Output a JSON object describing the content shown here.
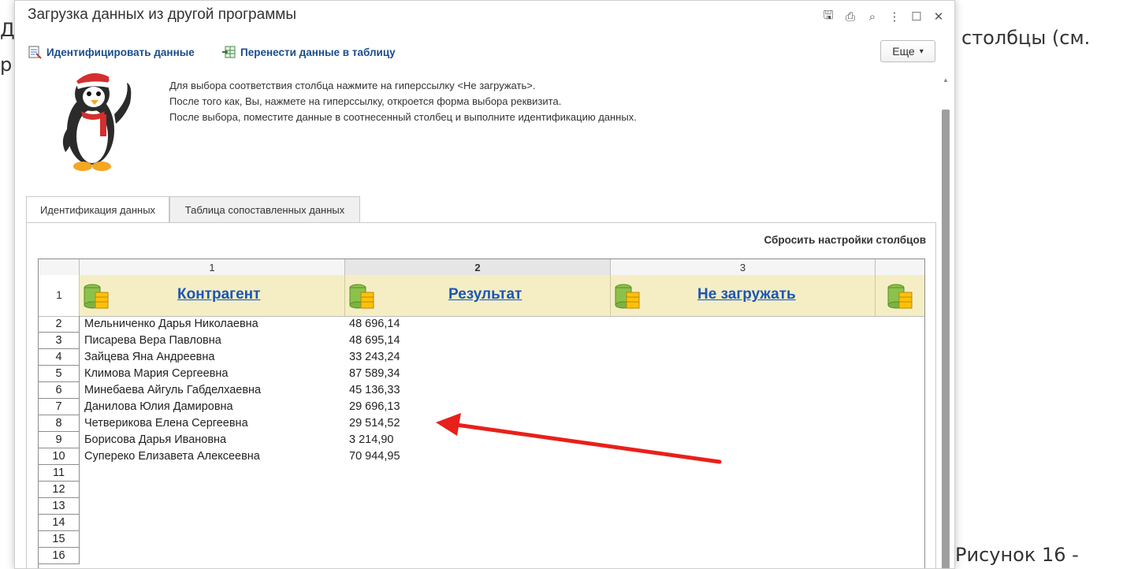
{
  "background": {
    "left_fragment_line1": "Д",
    "left_fragment_line2": "р",
    "right_fragment": "столбцы (см.",
    "figure_caption": "Рисунок 16 -"
  },
  "window": {
    "title": "Загрузка данных из другой программы",
    "title_icons": [
      "save-icon",
      "print-icon",
      "preview-icon",
      "more-vert-icon",
      "maximize-icon",
      "close-icon"
    ],
    "title_glyphs": {
      "save": "🖫",
      "print": "⎙",
      "preview": "⌕",
      "more": "⋮",
      "maximize": "☐",
      "close": "✕"
    }
  },
  "command_bar": {
    "identify_label": "Идентифицировать данные",
    "transfer_label": "Перенести данные в таблицу",
    "more_label": "Еще",
    "more_arrow": "▾"
  },
  "info": {
    "line1": "Для выбора соответствия столбца нажмите на гиперссылку <Не загружать>.",
    "line2": "После того как, Вы, нажмете на гиперссылку, откроется форма выбора реквизита.",
    "line3": "После выбора, поместите данные в соотнесенный столбец и выполните идентификацию данных."
  },
  "tabs": [
    {
      "label": "Идентификация данных",
      "active": true
    },
    {
      "label": "Таблица сопоставленных данных",
      "active": false
    }
  ],
  "reset_label": "Сбросить настройки столбцов",
  "grid": {
    "column_numbers": [
      "1",
      "2",
      "3"
    ],
    "header_row_number": "1",
    "column_names": [
      "Контрагент",
      "Результат",
      "Не загружать"
    ],
    "rows": [
      {
        "n": "2",
        "name": "Мельниченко Дарья Николаевна",
        "value": "48 696,14"
      },
      {
        "n": "3",
        "name": "Писарева Вера Павловна",
        "value": "48 695,14"
      },
      {
        "n": "4",
        "name": "Зайцева Яна Андреевна",
        "value": "33 243,24"
      },
      {
        "n": "5",
        "name": "Климова Мария Сергеевна",
        "value": "87 589,34"
      },
      {
        "n": "6",
        "name": "Минебаева Айгуль Габделхаевна",
        "value": "45 136,33"
      },
      {
        "n": "7",
        "name": "Данилова Юлия Дамировна",
        "value": "29 696,13"
      },
      {
        "n": "8",
        "name": "Четверикова Елена Сергеевна",
        "value": "29 514,52"
      },
      {
        "n": "9",
        "name": "Борисова Дарья Ивановна",
        "value": "3 214,90"
      },
      {
        "n": "10",
        "name": "Супереко Елизавета Алексеевна",
        "value": "70 944,95"
      },
      {
        "n": "11",
        "name": "",
        "value": ""
      },
      {
        "n": "12",
        "name": "",
        "value": ""
      },
      {
        "n": "13",
        "name": "",
        "value": ""
      },
      {
        "n": "14",
        "name": "",
        "value": ""
      },
      {
        "n": "15",
        "name": "",
        "value": ""
      },
      {
        "n": "16",
        "name": "",
        "value": ""
      }
    ]
  },
  "colors": {
    "header_row_bg": "#f5eec4",
    "link": "#1a56b8",
    "command_link": "#1a4d8c",
    "arrow": "#e8201a"
  }
}
